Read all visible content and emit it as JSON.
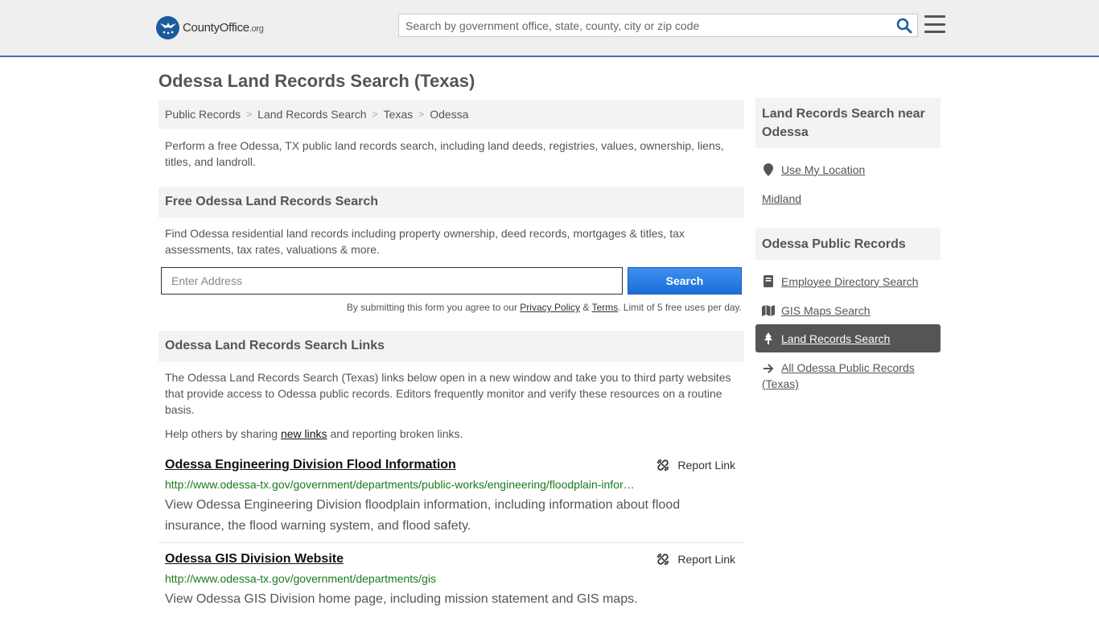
{
  "header": {
    "logo_main": "CountyOffice",
    "logo_suffix": ".org",
    "search_placeholder": "Search by government office, state, county, city or zip code"
  },
  "page": {
    "title": "Odessa Land Records Search (Texas)",
    "breadcrumb": [
      "Public Records",
      "Land Records Search",
      "Texas",
      "Odessa"
    ],
    "intro": "Perform a free Odessa, TX public land records search, including land deeds, registries, values, ownership, liens, titles, and landroll."
  },
  "free_search": {
    "heading": "Free Odessa Land Records Search",
    "text": "Find Odessa residential land records including property ownership, deed records, mortgages & titles, tax assessments, tax rates, valuations & more.",
    "input_placeholder": "Enter Address",
    "button_label": "Search",
    "terms_prefix": "By submitting this form you agree to our",
    "privacy_label": "Privacy Policy",
    "amp": "&",
    "terms_label": "Terms",
    "terms_suffix": ". Limit of 5 free uses per day."
  },
  "links_section": {
    "heading": "Odessa Land Records Search Links",
    "text": "The Odessa Land Records Search (Texas) links below open in a new window and take you to third party websites that provide access to Odessa public records. Editors frequently monitor and verify these resources on a routine basis.",
    "help_prefix": "Help others by sharing",
    "help_link": "new links",
    "help_suffix": "and reporting broken links.",
    "report_label": "Report Link",
    "entries": [
      {
        "title": "Odessa Engineering Division Flood Information",
        "url": "http://www.odessa-tx.gov/government/departments/public-works/engineering/floodplain-information",
        "desc": "View Odessa Engineering Division floodplain information, including information about flood insurance, the flood warning system, and flood safety."
      },
      {
        "title": "Odessa GIS Division Website",
        "url": "http://www.odessa-tx.gov/government/departments/gis",
        "desc": "View Odessa GIS Division home page, including mission statement and GIS maps."
      }
    ]
  },
  "sidebar": {
    "near_heading": "Land Records Search near Odessa",
    "use_location": "Use My Location",
    "nearby": [
      "Midland"
    ],
    "public_heading": "Odessa Public Records",
    "items": [
      {
        "label": "Employee Directory Search",
        "icon": "book-icon"
      },
      {
        "label": "GIS Maps Search",
        "icon": "map-icon"
      },
      {
        "label": "Land Records Search",
        "icon": "tree-icon",
        "active": true
      },
      {
        "label": "All Odessa Public Records (Texas)",
        "icon": "arrow-right-icon"
      }
    ]
  },
  "colors": {
    "accent_blue": "#1b6fd6",
    "header_bg": "#efefef",
    "url_green": "#1a7a1a",
    "active_bg": "#555555"
  }
}
